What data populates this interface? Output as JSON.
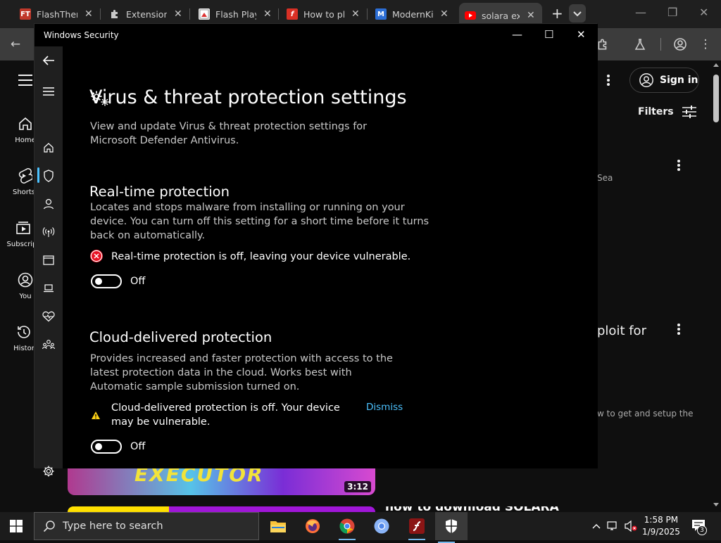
{
  "browser": {
    "tabs": [
      {
        "title": "FlashThem",
        "icon": "flashthemes-icon"
      },
      {
        "title": "Extensions",
        "icon": "puzzle-icon"
      },
      {
        "title": "Flash Playe",
        "icon": "flash-player-icon"
      },
      {
        "title": "How to pl",
        "icon": "flash-icon"
      },
      {
        "title": "ModernKi",
        "icon": "modernkit-icon"
      },
      {
        "title": "solara exe",
        "icon": "youtube-icon"
      }
    ]
  },
  "youtube": {
    "nav": [
      {
        "label": "Home",
        "icon": "home-icon"
      },
      {
        "label": "Shorts",
        "icon": "shorts-icon"
      },
      {
        "label": "Subscript",
        "icon": "subscriptions-icon"
      },
      {
        "label": "You",
        "icon": "you-icon"
      },
      {
        "label": "Histor",
        "icon": "history-icon"
      }
    ],
    "sign_in": "Sign in",
    "filters": "Filters",
    "snippet_sea": "Sea",
    "snippet_exploit": "ploit for",
    "snippet_setup": "w to get and setup the",
    "thumb_text": "EXECUTOR",
    "duration": "3:12",
    "cutoff_title": "how to download SOLARA executor"
  },
  "ws": {
    "window_title": "Windows Security",
    "page_title": "Virus & threat protection settings",
    "intro": "View and update Virus & threat protection settings for Microsoft Defender Antivirus.",
    "realtime": {
      "title": "Real-time protection",
      "desc": "Locates and stops malware from installing or running on your device. You can turn off this setting for a short time before it turns back on automatically.",
      "warning": "Real-time protection is off, leaving your device vulnerable.",
      "toggle_label": "Off"
    },
    "cloud": {
      "title": "Cloud-delivered protection",
      "desc": "Provides increased and faster protection with access to the latest protection data in the cloud. Works best with Automatic sample submission turned on.",
      "warning": "Cloud-delivered protection is off. Your device may be vulnerable.",
      "dismiss": "Dismiss",
      "toggle_label": "Off"
    },
    "colors": {
      "accent": "#4cc2ff",
      "error": "#e81123",
      "warning": "#fcd116"
    }
  },
  "taskbar": {
    "search_placeholder": "Type here to search",
    "time": "1:58 PM",
    "date": "1/9/2025",
    "notification_count": "3"
  }
}
